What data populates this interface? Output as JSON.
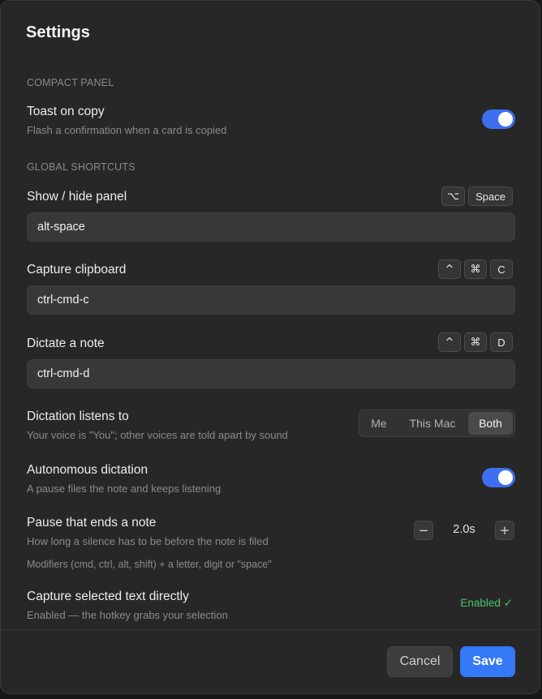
{
  "dialog": {
    "title": "Settings"
  },
  "sections": {
    "compact_panel": "COMPACT PANEL",
    "global_shortcuts": "GLOBAL SHORTCUTS"
  },
  "toast_on_copy": {
    "title": "Toast on copy",
    "description": "Flash a confirmation when a card is copied",
    "enabled": true
  },
  "show_hide_panel": {
    "title": "Show / hide panel",
    "keys": [
      "⌥",
      "Space"
    ],
    "value": "alt-space"
  },
  "capture_clipboard": {
    "title": "Capture clipboard",
    "keys": [
      "^",
      "⌘",
      "C"
    ],
    "value": "ctrl-cmd-c"
  },
  "dictate_note": {
    "title": "Dictate a note",
    "keys": [
      "^",
      "⌘",
      "D"
    ],
    "value": "ctrl-cmd-d"
  },
  "dictation_listens": {
    "title": "Dictation listens to",
    "description": "Your voice is \"You\"; other voices are told apart by sound",
    "options": [
      "Me",
      "This Mac",
      "Both"
    ],
    "selected": "Both"
  },
  "autonomous_dictation": {
    "title": "Autonomous dictation",
    "description": "A pause files the note and keeps listening",
    "enabled": true
  },
  "pause_ends_note": {
    "title": "Pause that ends a note",
    "description": "How long a silence has to be before the note is filed",
    "value": "2.0s",
    "minus": "−",
    "plus": "+"
  },
  "modifiers_hint": "Modifiers (cmd, ctrl, alt, shift) + a letter, digit or \"space\"",
  "capture_selected": {
    "title": "Capture selected text directly",
    "description": "Enabled — the hotkey grabs your selection",
    "status": "Enabled ✓"
  },
  "footer": {
    "cancel": "Cancel",
    "save": "Save"
  },
  "colors": {
    "accent": "#3478f6",
    "toggle_on": "#3d6ff0",
    "success": "#4cc36c"
  }
}
